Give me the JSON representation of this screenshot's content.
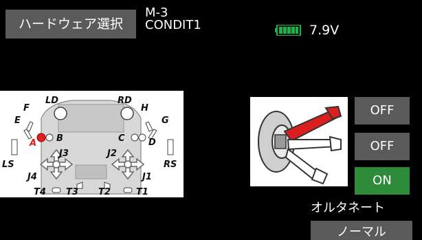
{
  "header": {
    "title_button": "ハードウェア選択",
    "model_name": "M-3",
    "condition_name": "CONDIT1",
    "battery_voltage": "7.9V",
    "battery_icon": "battery-icon"
  },
  "transmitter": {
    "labels": {
      "LD": "LD",
      "RD": "RD",
      "F": "F",
      "E": "E",
      "H": "H",
      "G": "G",
      "A": "A",
      "B": "B",
      "C": "C",
      "D": "D",
      "J3": "J3",
      "J2": "J2",
      "J4": "J4",
      "J1": "J1",
      "LS": "LS",
      "RS": "RS",
      "T4": "T4",
      "T3": "T3",
      "T2": "T2",
      "T1": "T1"
    },
    "colors": {
      "selected_switch": "#e02020",
      "stick": "#808080"
    }
  },
  "switch": {
    "positions": [
      "OFF",
      "OFF",
      "ON"
    ],
    "active_position_color": "#2e8b3a",
    "inactive_position_color": "#5a5a5a",
    "lever_up_color": "#d91f1f"
  },
  "footer": {
    "alternate_label": "オルタネート",
    "mode_button": "ノーマル"
  }
}
